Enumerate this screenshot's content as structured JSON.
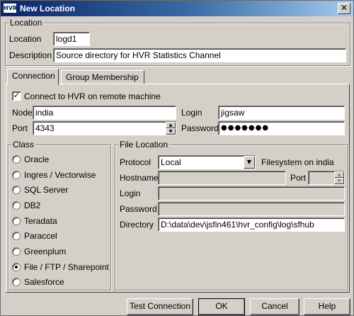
{
  "window": {
    "title": "New Location",
    "app_icon_text": "HVR",
    "close_glyph": "✕"
  },
  "location_group": {
    "legend": "Location",
    "location_label": "Location",
    "location_value": "logd1",
    "description_label": "Description",
    "description_value": "Source directory for HVR Statistics Channel"
  },
  "tabs": [
    {
      "label": "Connection",
      "active": true
    },
    {
      "label": "Group Membership",
      "active": false
    }
  ],
  "connection": {
    "remote_checkbox_label": "Connect to HVR on remote machine",
    "remote_checked": true,
    "node_label": "Node",
    "node_value": "india",
    "login_label": "Login",
    "login_value": "jigsaw",
    "port_label": "Port",
    "port_value": "4343",
    "password_label": "Password",
    "password_value": "●●●●●●●"
  },
  "class_group": {
    "legend": "Class",
    "options": [
      {
        "label": "Oracle",
        "checked": false
      },
      {
        "label": "Ingres / Vectorwise",
        "checked": false
      },
      {
        "label": "SQL Server",
        "checked": false
      },
      {
        "label": "DB2",
        "checked": false
      },
      {
        "label": "Teradata",
        "checked": false
      },
      {
        "label": "Paraccel",
        "checked": false
      },
      {
        "label": "Greenplum",
        "checked": false
      },
      {
        "label": "File / FTP / Sharepoint",
        "checked": true
      },
      {
        "label": "Salesforce",
        "checked": false
      }
    ]
  },
  "file_location": {
    "legend": "File Location",
    "protocol_label": "Protocol",
    "protocol_value": "Local",
    "filesystem_note": "Filesystem on india",
    "hostname_label": "Hostname",
    "port_label": "Port",
    "login_label": "Login",
    "password_label": "Password",
    "directory_label": "Directory",
    "directory_value": "D:\\data\\dev\\jsfin461\\hvr_config\\log\\sfhub"
  },
  "buttons": {
    "test_connection": "Test Connection",
    "ok": "OK",
    "cancel": "Cancel",
    "help": "Help"
  },
  "icons": {
    "spin_up": "▲",
    "spin_down": "▼",
    "dropdown": "▼",
    "check": "✓"
  }
}
